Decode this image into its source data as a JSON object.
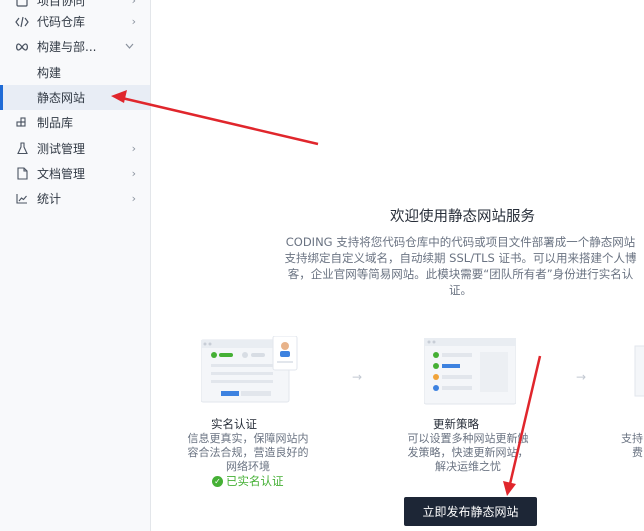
{
  "sidebar": {
    "top_partial": "项目协同",
    "items": [
      {
        "label": "代码仓库",
        "icon": "code-icon",
        "chevron": "›"
      },
      {
        "label": "构建与部...",
        "icon": "infinity-icon",
        "chevron": "⌄"
      },
      {
        "label": "构建",
        "icon": "",
        "chevron": ""
      },
      {
        "label": "静态网站",
        "icon": "",
        "chevron": ""
      },
      {
        "label": "制品库",
        "icon": "artifact-icon",
        "chevron": ""
      },
      {
        "label": "测试管理",
        "icon": "flask-icon",
        "chevron": "›"
      },
      {
        "label": "文档管理",
        "icon": "document-icon",
        "chevron": "›"
      },
      {
        "label": "统计",
        "icon": "chart-icon",
        "chevron": "›"
      }
    ]
  },
  "main": {
    "title": "欢迎使用静态网站服务",
    "desc_lines": [
      "CODING 支持将您代码仓库中的代码或项目文件部署成一个静态网站",
      "支持绑定自定义域名，自动续期 SSL/TLS 证书。可以用来搭建个人博",
      "客，企业官网等简易网站。此模块需要“团队所有者”身份进行实名认",
      "证。"
    ],
    "steps": [
      {
        "title": "实名认证",
        "lines": [
          "信息更真实，保障网站内",
          "容合法合规，营造良好的",
          "网络环境"
        ],
        "status": "已实名认证"
      },
      {
        "title": "更新策略",
        "lines": [
          "可以设置多种网站更新触",
          "发策略，快速更新网站，",
          "解决运维之忧"
        ]
      },
      {
        "title": "",
        "lines": [
          "支持",
          "费"
        ]
      }
    ],
    "publish_button": "立即发布静态网站"
  },
  "colors": {
    "annotation_red": "#e0262c",
    "primary_button": "#1d2636",
    "success_green": "#45b035",
    "active_accent": "#1f6bd6"
  }
}
